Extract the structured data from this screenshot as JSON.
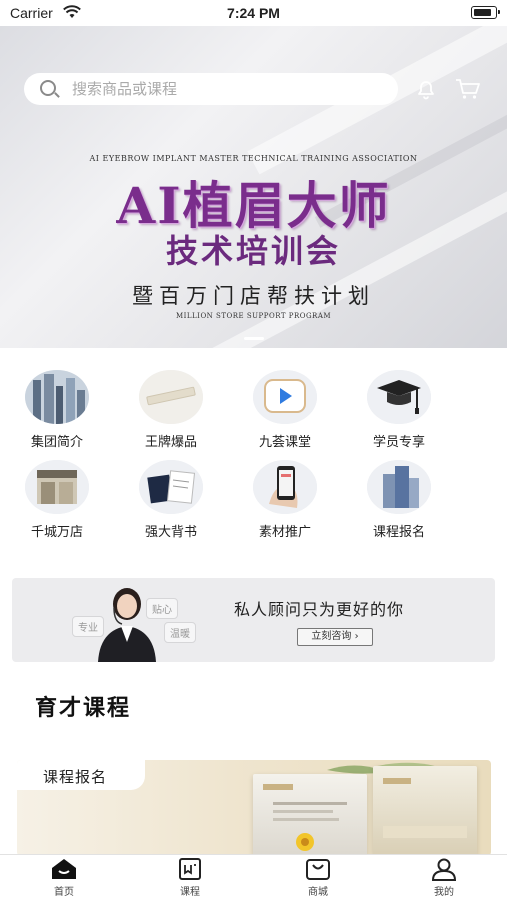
{
  "status_bar": {
    "carrier": "Carrier",
    "time": "7:24 PM"
  },
  "search": {
    "placeholder": "搜索商品或课程"
  },
  "hero": {
    "association": "AI EYEBROW IMPLANT MASTER TECHNICAL TRAINING ASSOCIATION",
    "title_line1": "AI植眉大师",
    "title_line2": "技术培训会",
    "tagline": "暨百万门店帮扶计划",
    "tagline_en": "MILLION STORE SUPPORT PROGRAM"
  },
  "grid": [
    {
      "label": "集团简介",
      "icon": "building-photo-icon"
    },
    {
      "label": "王牌爆品",
      "icon": "product-strip-icon"
    },
    {
      "label": "九荟课堂",
      "icon": "video-play-icon"
    },
    {
      "label": "学员专享",
      "icon": "graduation-cap-icon"
    },
    {
      "label": "千城万店",
      "icon": "storefront-icon"
    },
    {
      "label": "强大背书",
      "icon": "certificate-icon"
    },
    {
      "label": "素材推广",
      "icon": "phone-in-hand-icon"
    },
    {
      "label": "课程报名",
      "icon": "office-tower-icon"
    }
  ],
  "consult": {
    "bubbles": [
      "专业",
      "贴心",
      "温暖"
    ],
    "headline": "私人顾问只为更好的你",
    "button_label": "立刻咨询 ›"
  },
  "section": {
    "title": "育才课程"
  },
  "course_card": {
    "tab_label": "课程报名"
  },
  "tabbar": [
    {
      "label": "首页",
      "icon": "home-icon"
    },
    {
      "label": "课程",
      "icon": "course-book-icon"
    },
    {
      "label": "商城",
      "icon": "shopping-bag-icon"
    },
    {
      "label": "我的",
      "icon": "user-icon"
    }
  ]
}
